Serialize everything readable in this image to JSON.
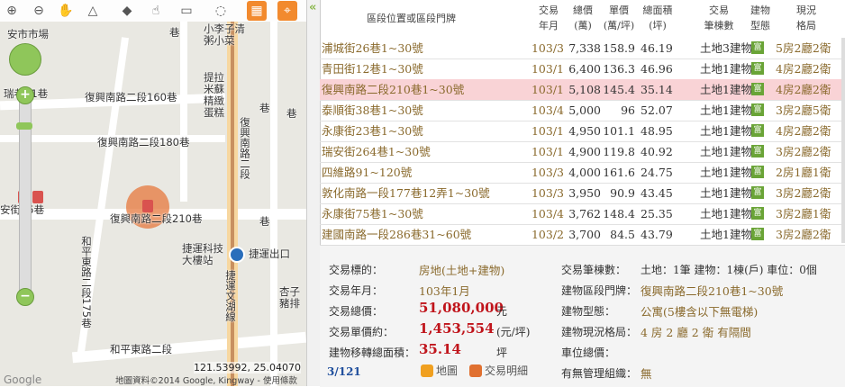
{
  "map": {
    "toolbar_icons": [
      "zoom-in-icon",
      "zoom-out-icon",
      "hand-pan-icon",
      "measure-angle-icon",
      "paint-bucket-icon",
      "pointer-icon",
      "rect-select-icon",
      "circle-select-icon",
      "layers-grid-icon",
      "location-pin-icon"
    ],
    "labels": {
      "anshi_market": "安市市場",
      "lane_top": "巷",
      "alley_small": "小李子清粥小菜",
      "lane81": "瑞巷81巷",
      "fuxing_160": "復興南路二段160巷",
      "fuxing_180": "復興南路二段180巷",
      "fuxing_210": "復興南路二段210巷",
      "fuxing_road": "復興南路二段",
      "tiqin": "提拉米蘇精緻蛋糕",
      "anxi_lane": "安街45巷",
      "heping_east": "和平東路二段175巷",
      "heping_east_road": "和平東路二段",
      "tech_building": "捷運科技大樓站",
      "mrt_exit": "捷運出口",
      "mrt_wenhu": "捷運文湖線",
      "xiangzi": "杏子豬排"
    },
    "coords": "121.53992, 25.04070",
    "copyright": "地圖資料©2014 Google, Kingway - 使用條款",
    "google": "Google"
  },
  "splitter_icon": "collapse-left-icon",
  "table": {
    "headers": {
      "addr": "區段位置或區段門牌",
      "ym": "交易\n年月",
      "total": "總價\n(萬)",
      "unit": "單價\n(萬/坪)",
      "area": "總面積\n(坪)",
      "count": "交易\n筆棟數",
      "type": "建物\n型態",
      "layout": "現況\n格局"
    },
    "type_badge": "富",
    "rows": [
      {
        "addr": "浦城街26巷1~30號",
        "ym": "103/3",
        "total": "7,338",
        "unit": "158.9",
        "area": "46.19",
        "count": "土地3建物1",
        "layout": "5房2廳2衛",
        "selected": false
      },
      {
        "addr": "青田街12巷1~30號",
        "ym": "103/1",
        "total": "6,400",
        "unit": "136.3",
        "area": "46.96",
        "count": "土地1建物1",
        "layout": "4房2廳2衛",
        "selected": false
      },
      {
        "addr": "復興南路二段210巷1~30號",
        "ym": "103/1",
        "total": "5,108",
        "unit": "145.4",
        "area": "35.14",
        "count": "土地1建物1",
        "layout": "4房2廳2衛",
        "selected": true
      },
      {
        "addr": "泰順街38巷1~30號",
        "ym": "103/4",
        "total": "5,000",
        "unit": "96",
        "area": "52.07",
        "count": "土地1建物1",
        "layout": "3房2廳5衛",
        "selected": false
      },
      {
        "addr": "永康街23巷1~30號",
        "ym": "103/1",
        "total": "4,950",
        "unit": "101.1",
        "area": "48.95",
        "count": "土地1建物1",
        "layout": "4房2廳2衛",
        "selected": false
      },
      {
        "addr": "瑞安街264巷1~30號",
        "ym": "103/1",
        "total": "4,900",
        "unit": "119.8",
        "area": "40.92",
        "count": "土地1建物1",
        "layout": "3房2廳2衛",
        "selected": false
      },
      {
        "addr": "四維路91~120號",
        "ym": "103/3",
        "total": "4,000",
        "unit": "161.6",
        "area": "24.75",
        "count": "土地1建物1",
        "layout": "2房1廳1衛",
        "selected": false
      },
      {
        "addr": "敦化南路一段177巷12弄1~30號",
        "ym": "103/3",
        "total": "3,950",
        "unit": "90.9",
        "area": "43.45",
        "count": "土地1建物1",
        "layout": "3房2廳2衛",
        "selected": false
      },
      {
        "addr": "永康街75巷1~30號",
        "ym": "103/4",
        "total": "3,762",
        "unit": "148.4",
        "area": "25.35",
        "count": "土地1建物1",
        "layout": "3房2廳1衛",
        "selected": false
      },
      {
        "addr": "建國南路一段286巷31~60號",
        "ym": "103/2",
        "total": "3,700",
        "unit": "84.5",
        "area": "43.79",
        "count": "土地1建物1",
        "layout": "3房2廳2衛",
        "selected": false
      }
    ]
  },
  "detail": {
    "trade_target_label": "交易標的：",
    "trade_target": "房地(土地+建物)",
    "trade_ym_label": "交易年月：",
    "trade_ym": "103年1月",
    "total_label": "交易總價：",
    "total": "51,080,000",
    "total_unit": "元",
    "unit_label": "交易單價約：",
    "unit_price": "1,453,554",
    "unit_price_unit": "(元/坪)",
    "area_label": "建物移轉總面積：",
    "area": "35.14",
    "area_unit": "坪",
    "pager": "3/121",
    "map_btn": "地圖",
    "detail_btn": "交易明細",
    "count_label": "交易筆棟數：",
    "count": "土地：1筆 建物：1棟(戶) 車位：0個",
    "addr_label": "建物區段門牌：",
    "addr": "復興南路二段210巷1~30號",
    "btype_label": "建物型態：",
    "btype": "公寓(5樓含以下無電梯)",
    "blayout_label": "建物現況格局：",
    "blayout": "4 房 2 廳 2 衛 有隔間",
    "parking_label": "車位總價：",
    "mgmt_label": "有無管理組織：",
    "mgmt": "無"
  }
}
